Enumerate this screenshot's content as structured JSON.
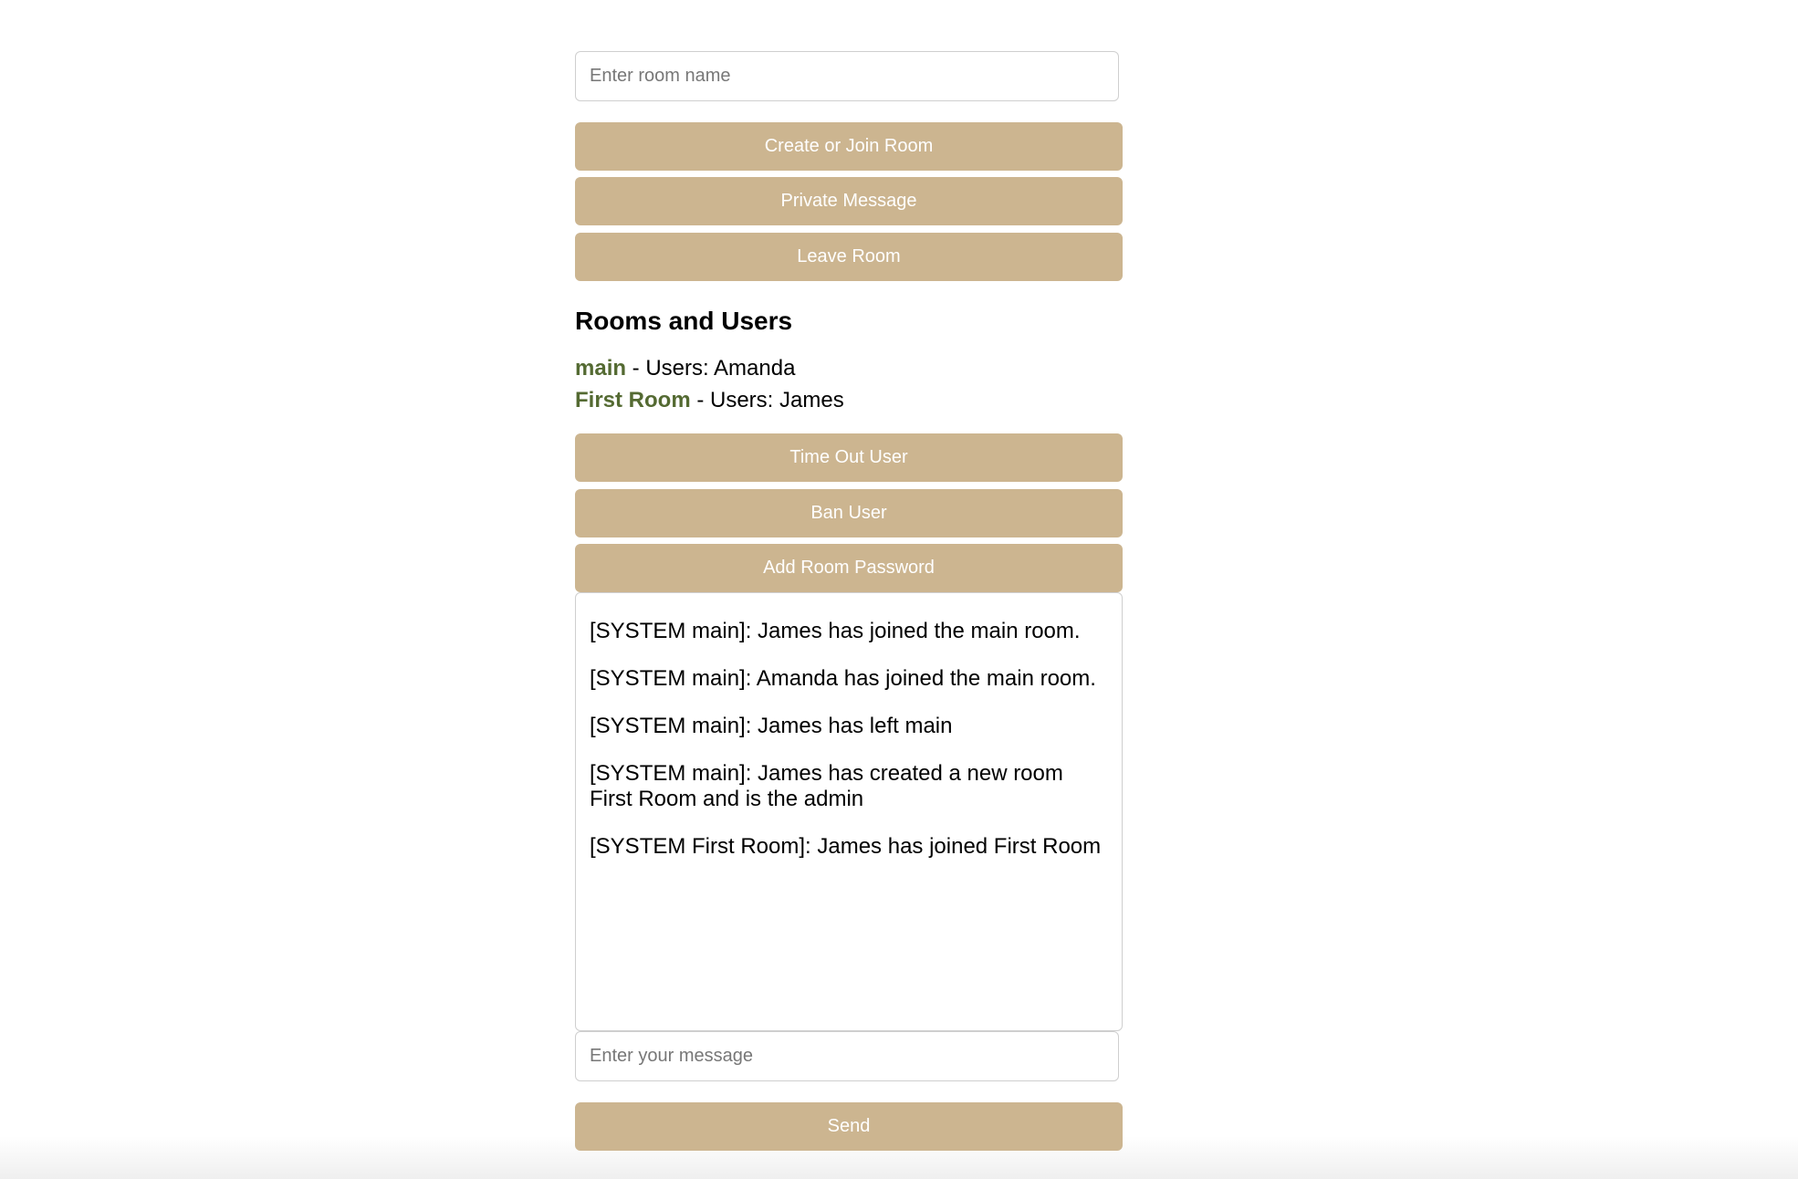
{
  "room_form": {
    "room_name_placeholder": "Enter room name",
    "create_join_label": "Create or Join Room",
    "private_message_label": "Private Message",
    "leave_room_label": "Leave Room"
  },
  "rooms_section": {
    "title": "Rooms and Users",
    "rooms": [
      {
        "name": "main",
        "users_text": " - Users: Amanda"
      },
      {
        "name": "First Room",
        "users_text": " - Users: James"
      }
    ]
  },
  "admin_actions": {
    "time_out_label": "Time Out User",
    "ban_label": "Ban User",
    "add_password_label": "Add Room Password"
  },
  "chat": {
    "messages": [
      "[SYSTEM main]: James has joined the main room.",
      "[SYSTEM main]: Amanda has joined the main room.",
      "[SYSTEM main]: James has left main",
      "[SYSTEM main]: James has created a new room First Room and is the admin",
      "[SYSTEM First Room]: James has joined First Room"
    ],
    "message_placeholder": "Enter your message",
    "send_label": "Send"
  },
  "colors": {
    "button_bg": "#ccb590",
    "room_name": "#546a32"
  }
}
